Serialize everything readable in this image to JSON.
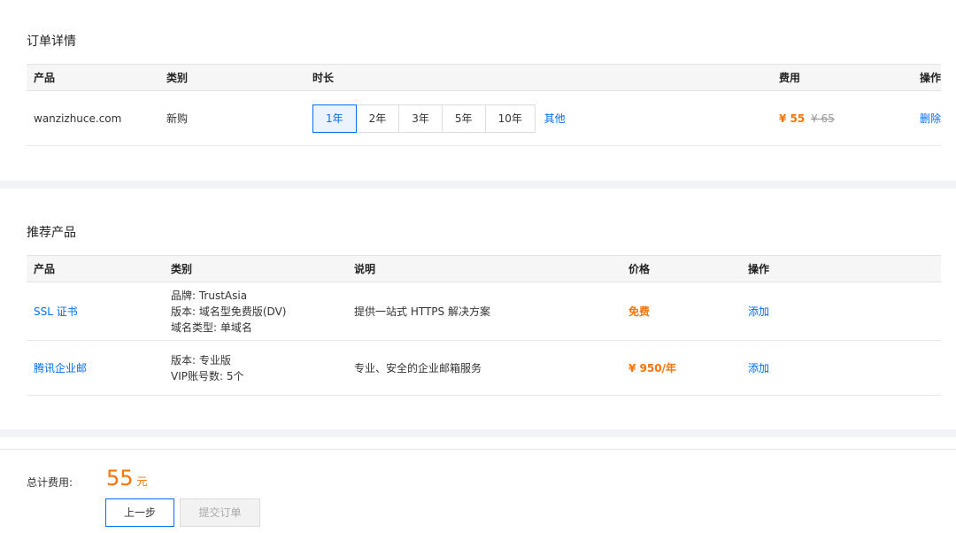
{
  "order": {
    "title": "订单详情",
    "headers": {
      "product": "产品",
      "category": "类别",
      "duration": "时长",
      "fee": "费用",
      "action": "操作"
    },
    "row": {
      "product": "wanzizhuce.com",
      "category": "新购",
      "durations": [
        "1年",
        "2年",
        "3年",
        "5年",
        "10年"
      ],
      "active_duration": "1年",
      "other": "其他",
      "price": "¥ 55",
      "original_price": "¥ 65",
      "action": "删除"
    }
  },
  "recommend": {
    "title": "推荐产品",
    "headers": {
      "product": "产品",
      "category": "类别",
      "desc": "说明",
      "price": "价格",
      "action": "操作"
    },
    "rows": [
      {
        "product": "SSL 证书",
        "category_lines": [
          "品牌: TrustAsia",
          "版本: 域名型免费版(DV)",
          "域名类型: 单域名"
        ],
        "desc": "提供一站式 HTTPS 解决方案",
        "price": "免费",
        "action": "添加"
      },
      {
        "product": "腾讯企业邮",
        "category_lines": [
          "版本: 专业版",
          "VIP账号数: 5个"
        ],
        "desc": "专业、安全的企业邮箱服务",
        "price": "¥ 950/年",
        "action": "添加"
      }
    ]
  },
  "summary": {
    "label": "总计费用:",
    "amount": "55",
    "unit": "元",
    "prev_button": "上一步",
    "submit_button": "提交订单"
  },
  "colors": {
    "accent": "#006eff",
    "price": "#ff7200",
    "band": "#f2f3f6"
  }
}
